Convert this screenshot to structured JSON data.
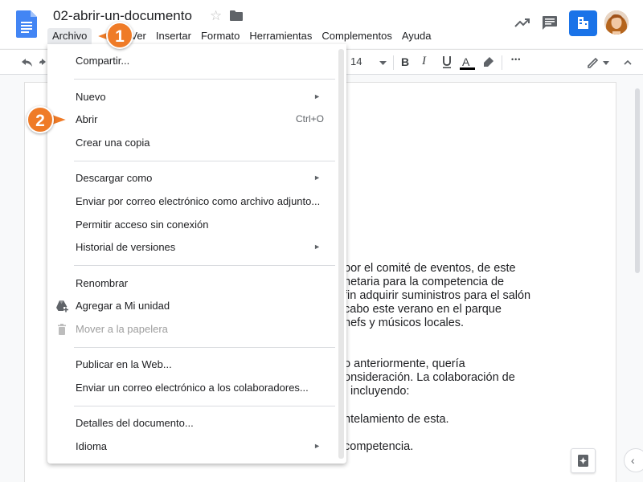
{
  "doc": {
    "title": "02-abrir-un-documento",
    "body_lines_1": [
      "por el comité de eventos, de este",
      "netaria para la competencia de",
      "fin adquirir suministros para el salón",
      "cabo este verano en el parque",
      "hefs y músicos locales."
    ],
    "body_lines_2": [
      "o anteriormente, quería",
      "onsideración. La colaboración de",
      ", incluyendo:"
    ],
    "body_line_3": "ntelamiento de esta.",
    "body_line_4": "competencia."
  },
  "menubar": {
    "items": [
      "Archivo",
      "Ver",
      "Insertar",
      "Formato",
      "Herramientas",
      "Complementos",
      "Ayuda"
    ]
  },
  "toolbar": {
    "font_size": "14",
    "bold": "B",
    "italic": "I",
    "text_color": "A",
    "more": "•••"
  },
  "file_menu": {
    "share": "Compartir...",
    "new": "Nuevo",
    "open": "Abrir",
    "open_shortcut": "Ctrl+O",
    "make_copy": "Crear una copia",
    "download_as": "Descargar como",
    "email_attachment": "Enviar por correo electrónico como archivo adjunto...",
    "offline": "Permitir acceso sin conexión",
    "version_history": "Historial de versiones",
    "rename": "Renombrar",
    "add_to_drive": "Agregar a Mi unidad",
    "move_to_trash": "Mover a la papelera",
    "publish": "Publicar en la Web...",
    "email_collaborators": "Enviar un correo electrónico a los colaboradores...",
    "details": "Detalles del documento...",
    "language": "Idioma"
  },
  "callouts": [
    "1",
    "2"
  ],
  "colors": {
    "callout": "#ef7b27",
    "share_button": "#1a73e8",
    "docs_blue": "#4285f4"
  }
}
